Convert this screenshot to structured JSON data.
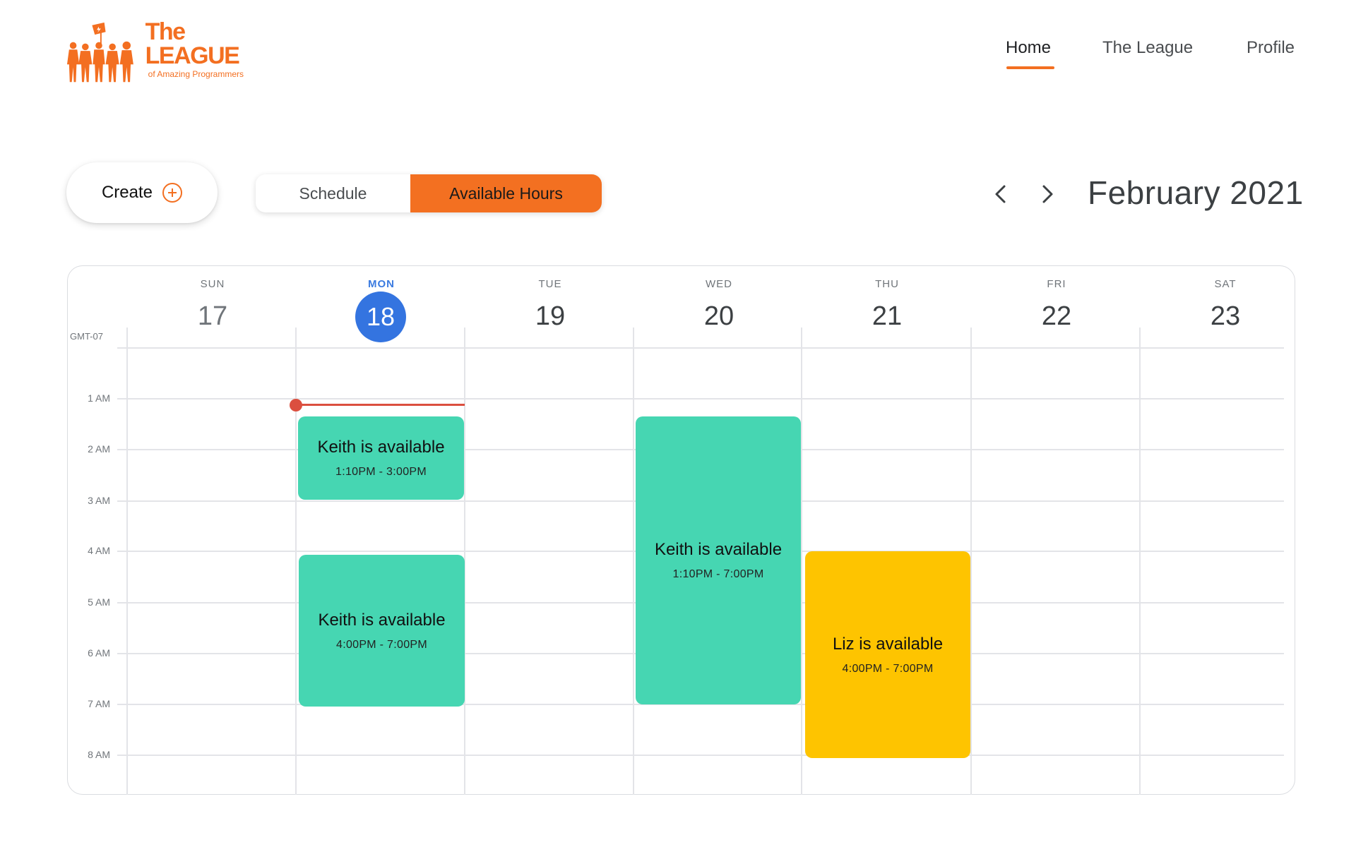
{
  "brand": {
    "title": "The LEAGUE",
    "subtitle": "of Amazing Programmers",
    "color": "#f36f21"
  },
  "nav": {
    "items": [
      {
        "label": "Home",
        "active": true
      },
      {
        "label": "The League",
        "active": false
      },
      {
        "label": "Profile",
        "active": false
      }
    ]
  },
  "toolbar": {
    "create_label": "Create",
    "create_icon": "plus-circle-icon",
    "view_toggle": [
      {
        "label": "Schedule",
        "active": false
      },
      {
        "label": "Available Hours",
        "active": true
      }
    ],
    "prev_icon": "chevron-left-icon",
    "next_icon": "chevron-right-icon",
    "month_title": "February 2021"
  },
  "calendar": {
    "timezone": "GMT-07",
    "days": [
      {
        "dow": "SUN",
        "date": "17",
        "today": false
      },
      {
        "dow": "MON",
        "date": "18",
        "today": true
      },
      {
        "dow": "TUE",
        "date": "19",
        "today": false
      },
      {
        "dow": "WED",
        "date": "20",
        "today": false
      },
      {
        "dow": "THU",
        "date": "21",
        "today": false
      },
      {
        "dow": "FRI",
        "date": "22",
        "today": false
      },
      {
        "dow": "SAT",
        "date": "23",
        "today": false
      }
    ],
    "hours": [
      "1 AM",
      "2 AM",
      "3 AM",
      "4 AM",
      "5 AM",
      "6 AM",
      "7 AM",
      "8 AM"
    ],
    "now_day": "MON",
    "events": [
      {
        "title": "Keith is available",
        "time": "1:10PM - 3:00PM",
        "day": "MON",
        "color": "#46d6b2"
      },
      {
        "title": "Keith is available",
        "time": "4:00PM - 7:00PM",
        "day": "MON",
        "color": "#46d6b2"
      },
      {
        "title": "Keith is available",
        "time": "1:10PM - 7:00PM",
        "day": "WED",
        "color": "#46d6b2"
      },
      {
        "title": "Liz is available",
        "time": "4:00PM - 7:00PM",
        "day": "THU",
        "color": "#fec400"
      }
    ],
    "today_color": "#3474e0",
    "now_indicator_color": "#db4f3f"
  }
}
